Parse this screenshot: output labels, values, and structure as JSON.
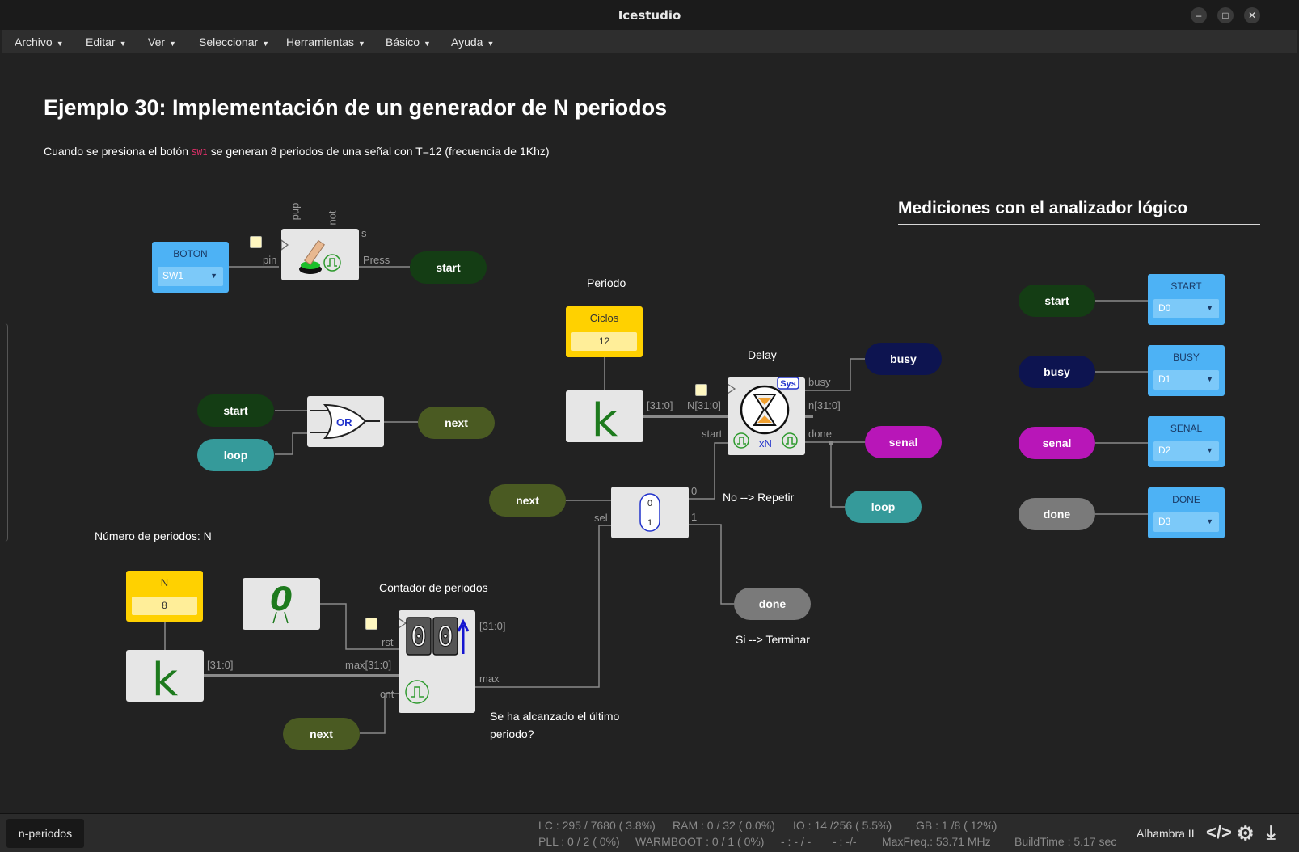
{
  "window": {
    "title": "Icestudio"
  },
  "menu": [
    "Archivo",
    "Editar",
    "Ver",
    "Seleccionar",
    "Herramientas",
    "Básico",
    "Ayuda"
  ],
  "heading": "Ejemplo 30: Implementación de un generador de N periodos",
  "description": {
    "before": "Cuando se presiona el botón",
    "code": "SW1",
    "after": "se generan 8 periodos de una señal con T=12 (frecuencia de 1Khz)"
  },
  "analyzer_title": "Mediciones con el analizador lógico",
  "notes": {
    "periodo": "Periodo",
    "delay": "Delay",
    "no_repetir": "No --> Repetir",
    "si_terminar": "Si --> Terminar",
    "numero_periodos": "Número de periodos: N",
    "contador": "Contador de periodos",
    "ultimo_1": "Se ha alcanzado el último",
    "ultimo_2": "periodo?"
  },
  "inputs": {
    "boton": {
      "label": "BOTON",
      "value": "SW1"
    }
  },
  "outputs": [
    {
      "label": "START",
      "value": "D0"
    },
    {
      "label": "BUSY",
      "value": "D1"
    },
    {
      "label": "SENAL",
      "value": "D2"
    },
    {
      "label": "DONE",
      "value": "D3"
    }
  ],
  "constants": {
    "ciclos": {
      "label": "Ciclos",
      "value": "12"
    },
    "n": {
      "label": "N",
      "value": "8"
    }
  },
  "labels": {
    "start": "start",
    "next": "next",
    "loop": "loop",
    "busy": "busy",
    "senal": "senal",
    "done": "done"
  },
  "blocks": {
    "or_label": "OR",
    "k_symbol": "k",
    "zero_symbol": "0",
    "delay_sys": "Sys",
    "delay_xn": "xN",
    "counter_digits": [
      "0",
      "0"
    ],
    "mux_in": [
      "0",
      "1"
    ]
  },
  "ports": {
    "pup": "pup",
    "not": "not",
    "s": "s",
    "pin": "pin",
    "press": "Press",
    "bus31": "[31:0]",
    "n31_in": "N[31:0]",
    "n31_out": "n[31:0]",
    "busy": "busy",
    "start": "start",
    "done": "done",
    "mux0": "0",
    "mux1": "1",
    "sel": "sel",
    "rst": "rst",
    "max31": "max[31:0]",
    "cnt": "cnt",
    "max": "max"
  },
  "status": {
    "tab": "n-periodos",
    "row1": [
      "LC : 295 / 7680 ( 3.8%)",
      "RAM : 0 / 32 ( 0.0%)",
      "IO : 14 /256 ( 5.5%)",
      "GB : 1 /8 ( 12%)"
    ],
    "row2": [
      "PLL : 0 / 2 ( 0%)",
      "WARMBOOT : 0 / 1 ( 0%)",
      "- : - / -",
      "- : -/-",
      "MaxFreq.: 53.71 MHz",
      "BuildTime : 5.17 sec"
    ],
    "board": "Alhambra II"
  },
  "colors": {
    "background": "#222222",
    "input_block": "#4db2f5",
    "constant_block": "#ffd100",
    "dark_green": "#143d14",
    "olive": "#4a5a22",
    "teal": "#359a9a",
    "navy": "#0d1450",
    "magenta": "#b816b8",
    "grey": "#7a7a7a"
  }
}
